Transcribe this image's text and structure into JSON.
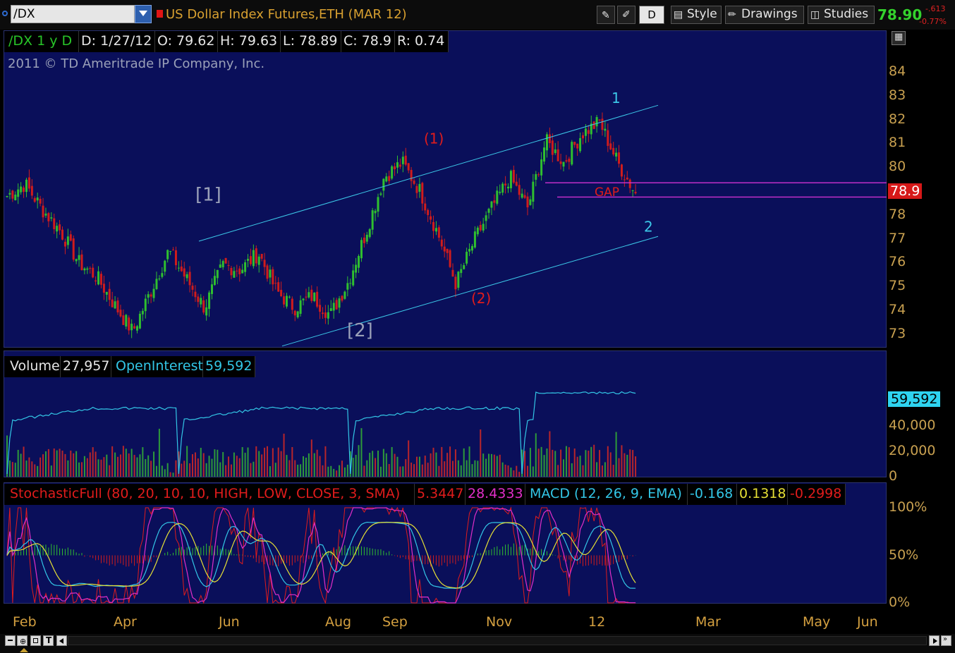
{
  "toolbar": {
    "symbol": "/DX",
    "instrument": "US Dollar Index Futures,ETH (MAR 12)",
    "period_button": "D",
    "style_label": "Style",
    "drawings_label": "Drawings",
    "studies_label": "Studies",
    "last_price": "78.90",
    "net_change": "-.613",
    "pct_change": "-0.77%"
  },
  "price_panel": {
    "header": {
      "symbol_period": "/DX 1 y D",
      "date": "D: 1/27/12",
      "open": "O: 79.62",
      "high": "H: 79.63",
      "low": "L: 78.89",
      "close": "C: 78.9",
      "range": "R: 0.74"
    },
    "copyright": "2011 © TD Ameritrade IP Company, Inc.",
    "current_price_badge": "78.9"
  },
  "volume_panel": {
    "volume_label": "Volume",
    "volume_value": "27,957",
    "oi_label": "OpenInterest",
    "oi_value": "59,592",
    "oi_badge": "59,592"
  },
  "osc_panel": {
    "stoch_label": "StochasticFull (80, 20, 10, 10, HIGH, LOW, CLOSE, 3, SMA)",
    "stoch_k": "5.3447",
    "stoch_d": "28.4333",
    "macd_label": "MACD (12, 26, 9, EMA)",
    "macd_value": "-0.168",
    "macd_avg": "0.1318",
    "macd_diff": "-0.2998"
  },
  "chart_data": [
    {
      "type": "candlestick",
      "title": "/DX 1 y D",
      "ylim": [
        72.5,
        84.5
      ],
      "y_ticks": [
        73,
        74,
        75,
        76,
        77,
        78,
        79,
        80,
        81,
        82,
        83,
        84
      ],
      "x_tick_labels": [
        "Feb",
        "Apr",
        "Jun",
        "Aug",
        "Sep",
        "Nov",
        "12",
        "Mar",
        "May",
        "Jun"
      ],
      "close_path": [
        [
          "Feb",
          78.8
        ],
        [
          "Feb",
          79.3
        ],
        [
          "Mar",
          78.2
        ],
        [
          "Mar",
          77.3
        ],
        [
          "Apr",
          76.0
        ],
        [
          "Apr",
          75.4
        ],
        [
          "Apr",
          74.2
        ],
        [
          "Apr",
          73.1
        ],
        [
          "May",
          74.8
        ],
        [
          "May",
          76.5
        ],
        [
          "Jun",
          75.3
        ],
        [
          "Jun",
          74.1
        ],
        [
          "Jun",
          75.9
        ],
        [
          "Jul",
          75.7
        ],
        [
          "Jul",
          76.4
        ],
        [
          "Jul",
          74.8
        ],
        [
          "Aug",
          74.1
        ],
        [
          "Aug",
          74.6
        ],
        [
          "Aug",
          73.8
        ],
        [
          "Sep",
          75.2
        ],
        [
          "Sep",
          77.3
        ],
        [
          "Sep",
          79.6
        ],
        [
          "Sep",
          80.2
        ],
        [
          "Oct",
          79.0
        ],
        [
          "Oct",
          77.2
        ],
        [
          "Oct",
          75.1
        ],
        [
          "Oct",
          76.9
        ],
        [
          "Nov",
          78.3
        ],
        [
          "Nov",
          79.6
        ],
        [
          "Nov",
          78.3
        ],
        [
          "Nov",
          81.1
        ],
        [
          "Dec",
          80.2
        ],
        [
          "Dec",
          81.4
        ],
        [
          "Jan",
          81.9
        ],
        [
          "Jan",
          80.2
        ],
        [
          "Jan",
          78.9
        ]
      ],
      "annotations": [
        "(1)",
        "(2)",
        "1",
        "2",
        "[1]",
        "[2]",
        "GAP"
      ],
      "trend_channel": "upward parallel channel (cyan)",
      "gap_lines_levels": [
        79.35,
        78.75
      ],
      "grid": false
    },
    {
      "type": "bar",
      "title": "Volume / OpenInterest",
      "ylim": [
        0,
        80000
      ],
      "y_ticks": [
        "0",
        "20,000",
        "40,000"
      ],
      "series": [
        {
          "name": "Volume",
          "colors": [
            "#2e9a3a",
            "#b8252b"
          ]
        },
        {
          "name": "OpenInterest",
          "line_color": "#33c6e6"
        }
      ]
    },
    {
      "type": "line",
      "title": "StochasticFull / MACD",
      "ylim": [
        0,
        100
      ],
      "y_ticks": [
        "0%",
        "50%",
        "100%"
      ],
      "series": [
        {
          "name": "StochasticFull",
          "color": "#e01c1c"
        },
        {
          "name": "StochasticFull",
          "color": "#e12ec8"
        },
        {
          "name": "MACD",
          "color": "#33c6e6"
        },
        {
          "name": "MACD",
          "color": "#e6e035"
        }
      ]
    }
  ]
}
